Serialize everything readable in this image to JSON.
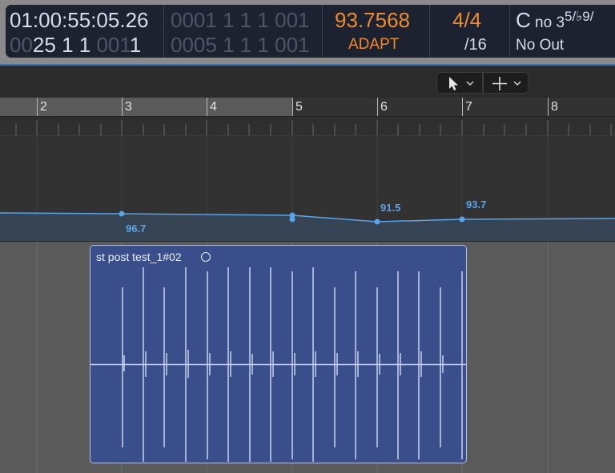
{
  "lcd": {
    "smpte": "01:00:55:05.26",
    "smpte_sub_dim": "00",
    "smpte_sub": "25 1 1",
    "smpte_sub_dim2": " 001",
    "smpte_sub_end": "1",
    "position_dim": "0001",
    "position": " 1  1  1",
    "position_dim2": " 001",
    "end_dim": "0005",
    "end": " 1  1  1",
    "end_dim2": " 001",
    "tempo": "93.7568",
    "tempo_mode": "ADAPT",
    "sig_top": "4/4",
    "sig_bottom": "/16",
    "key": "C",
    "key_detail": " no 3",
    "key_sup": "5/♭9/",
    "midi_out": "No Out"
  },
  "toolbar": {
    "pointer_tool": "pointer-icon",
    "crosshair_tool": "crosshair-icon"
  },
  "ruler": {
    "bars": [
      "2",
      "3",
      "4",
      "5",
      "6",
      "7",
      "8"
    ]
  },
  "tempo": {
    "labels": [
      "96.7",
      "91.5",
      "93.7"
    ]
  },
  "region": {
    "name": "st post test_1#02"
  },
  "colors": {
    "lcd_bg": "#1d2230",
    "accent_orange": "#ef8a2e",
    "tempo_line": "#5aa4ec",
    "region_fill": "#3a4e8c"
  }
}
